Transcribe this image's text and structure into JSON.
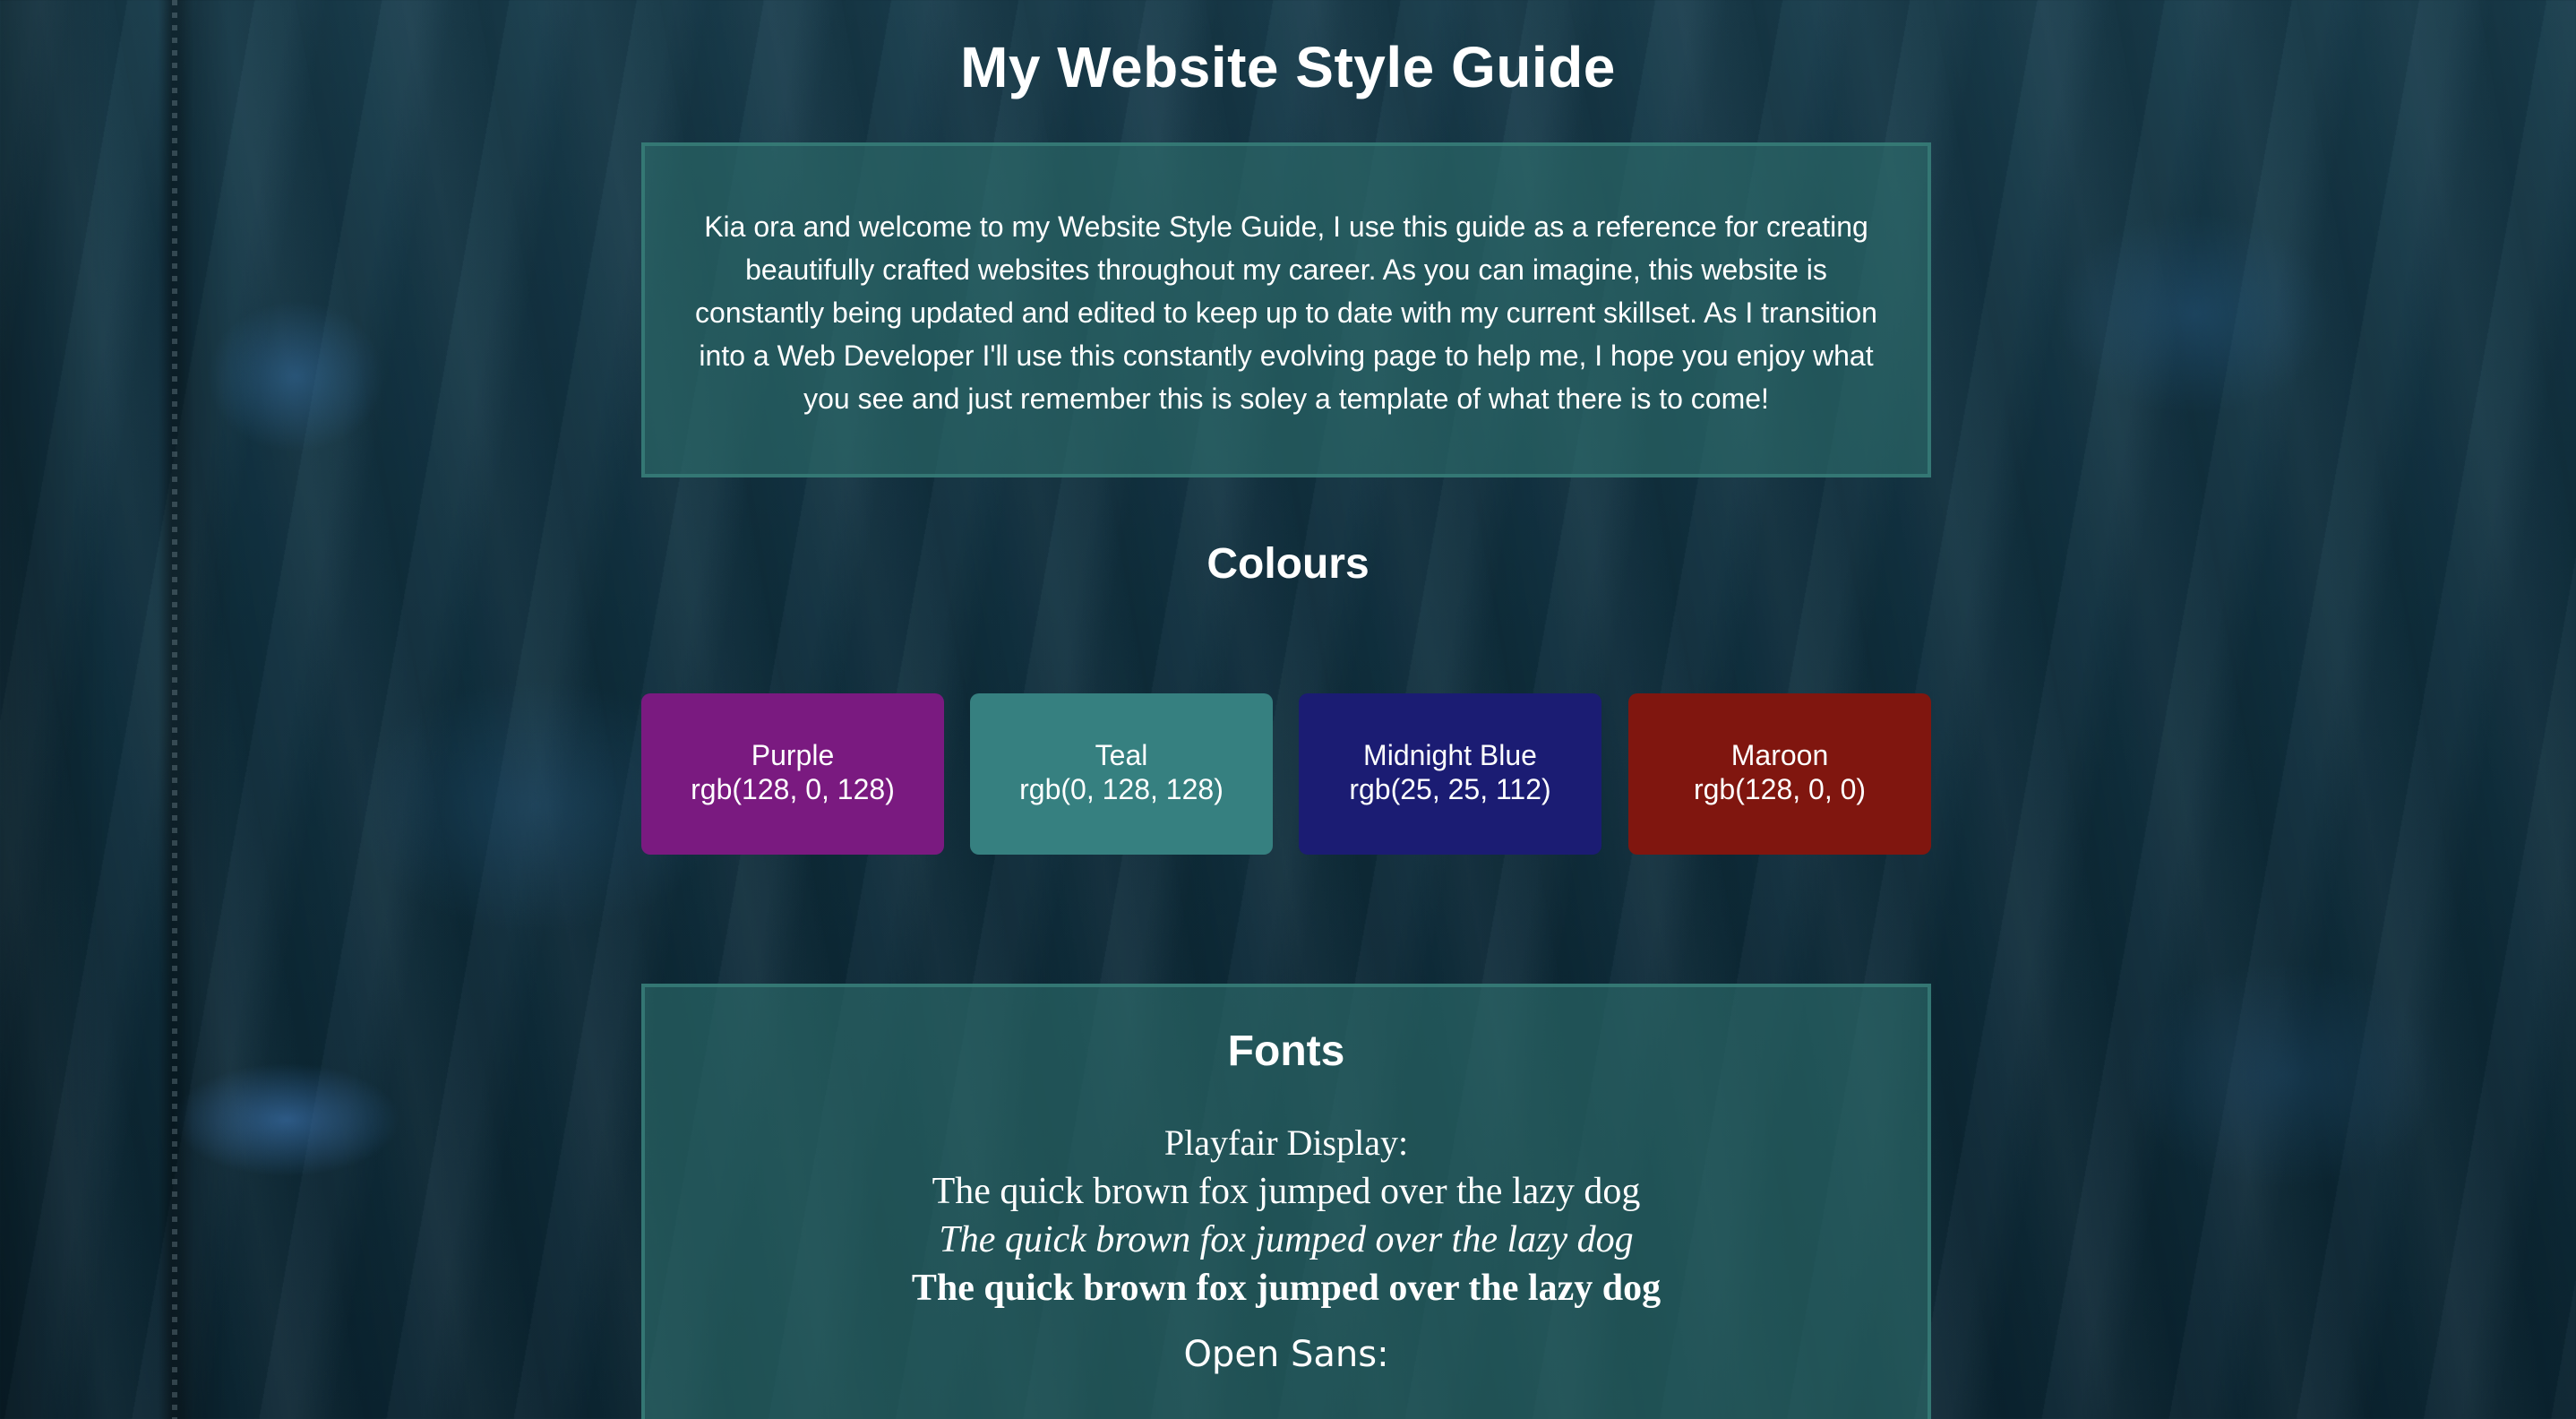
{
  "page": {
    "title": "My Website Style Guide"
  },
  "intro": {
    "text": "Kia ora and welcome to my Website Style Guide, I use this guide as a reference for creating beautifully crafted websites throughout my career. As you can imagine, this website is constantly being updated and edited to keep up to date with my current skillset. As I transition into a Web Developer I'll use this constantly evolving page to help me, I hope you enjoy what you see and just remember this is soley a template of what there is to come!"
  },
  "colours": {
    "heading": "Colours",
    "swatches": [
      {
        "name": "Purple",
        "value": "rgb(128, 0, 128)",
        "color": "#7a1a80"
      },
      {
        "name": "Teal",
        "value": "rgb(0, 128, 128)",
        "color": "#368080"
      },
      {
        "name": "Midnight Blue",
        "value": "rgb(25, 25, 112)",
        "color": "#1b1c73"
      },
      {
        "name": "Maroon",
        "value": "rgb(128, 0, 0)",
        "color": "#80160f"
      }
    ]
  },
  "fonts": {
    "heading": "Fonts",
    "playfair": {
      "label": "Playfair Display:",
      "regular": "The quick brown fox jumped over the lazy dog",
      "italic": "The quick brown fox jumped over the lazy dog",
      "bold": "The quick brown fox jumped over the lazy dog"
    },
    "open_sans": {
      "label": "Open Sans:"
    }
  }
}
